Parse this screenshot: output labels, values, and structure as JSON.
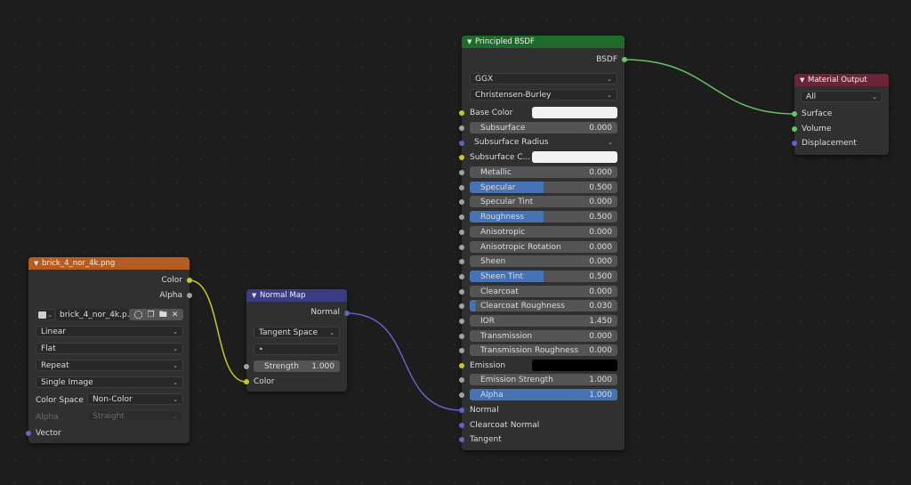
{
  "image_node": {
    "title": "brick_4_nor_4k.png",
    "outputs": [
      "Color",
      "Alpha"
    ],
    "image_name": "brick_4_nor_4k.p...",
    "interpolation": "Linear",
    "projection": "Flat",
    "extension": "Repeat",
    "source": "Single Image",
    "color_space_label": "Color Space",
    "color_space_value": "Non-Color",
    "alpha_label": "Alpha",
    "alpha_value": "Straight",
    "input": "Vector",
    "header_color": "#b35d22"
  },
  "normal_map_node": {
    "title": "Normal Map",
    "output": "Normal",
    "space": "Tangent Space",
    "uv_placeholder": "",
    "strength_label": "Strength",
    "strength_value": "1.000",
    "input": "Color",
    "header_color": "#3c3c83"
  },
  "bsdf_node": {
    "title": "Principled BSDF",
    "output": "BSDF",
    "distribution": "GGX",
    "subsurface_method": "Christensen-Burley",
    "base_color_label": "Base Color",
    "subsurface": {
      "label": "Subsurface",
      "value": "0.000"
    },
    "subsurface_radius": "Subsurface Radius",
    "subsurface_color_label": "Subsurface C...",
    "params": [
      {
        "label": "Metallic",
        "value": "0.000",
        "fill": 0
      },
      {
        "label": "Specular",
        "value": "0.500",
        "fill": 0.5
      },
      {
        "label": "Specular Tint",
        "value": "0.000",
        "fill": 0
      },
      {
        "label": "Roughness",
        "value": "0.500",
        "fill": 0.5
      },
      {
        "label": "Anisotropic",
        "value": "0.000",
        "fill": 0
      },
      {
        "label": "Anisotropic Rotation",
        "value": "0.000",
        "fill": 0
      },
      {
        "label": "Sheen",
        "value": "0.000",
        "fill": 0
      },
      {
        "label": "Sheen Tint",
        "value": "0.500",
        "fill": 0.5
      },
      {
        "label": "Clearcoat",
        "value": "0.000",
        "fill": 0
      },
      {
        "label": "Clearcoat Roughness",
        "value": "0.030",
        "fill": 0.03
      },
      {
        "label": "IOR",
        "value": "1.450",
        "fill": 0
      },
      {
        "label": "Transmission",
        "value": "0.000",
        "fill": 0
      },
      {
        "label": "Transmission Roughness",
        "value": "0.000",
        "fill": 0
      }
    ],
    "emission_label": "Emission",
    "emission_strength": {
      "label": "Emission Strength",
      "value": "1.000"
    },
    "alpha": {
      "label": "Alpha",
      "value": "1.000",
      "fill": 1
    },
    "normal_label": "Normal",
    "clearcoat_normal_label": "Clearcoat Normal",
    "tangent_label": "Tangent",
    "header_color": "#1f6b2c"
  },
  "output_node": {
    "title": "Material Output",
    "target": "All",
    "inputs": [
      "Surface",
      "Volume",
      "Displacement"
    ],
    "header_color": "#6b2536"
  }
}
